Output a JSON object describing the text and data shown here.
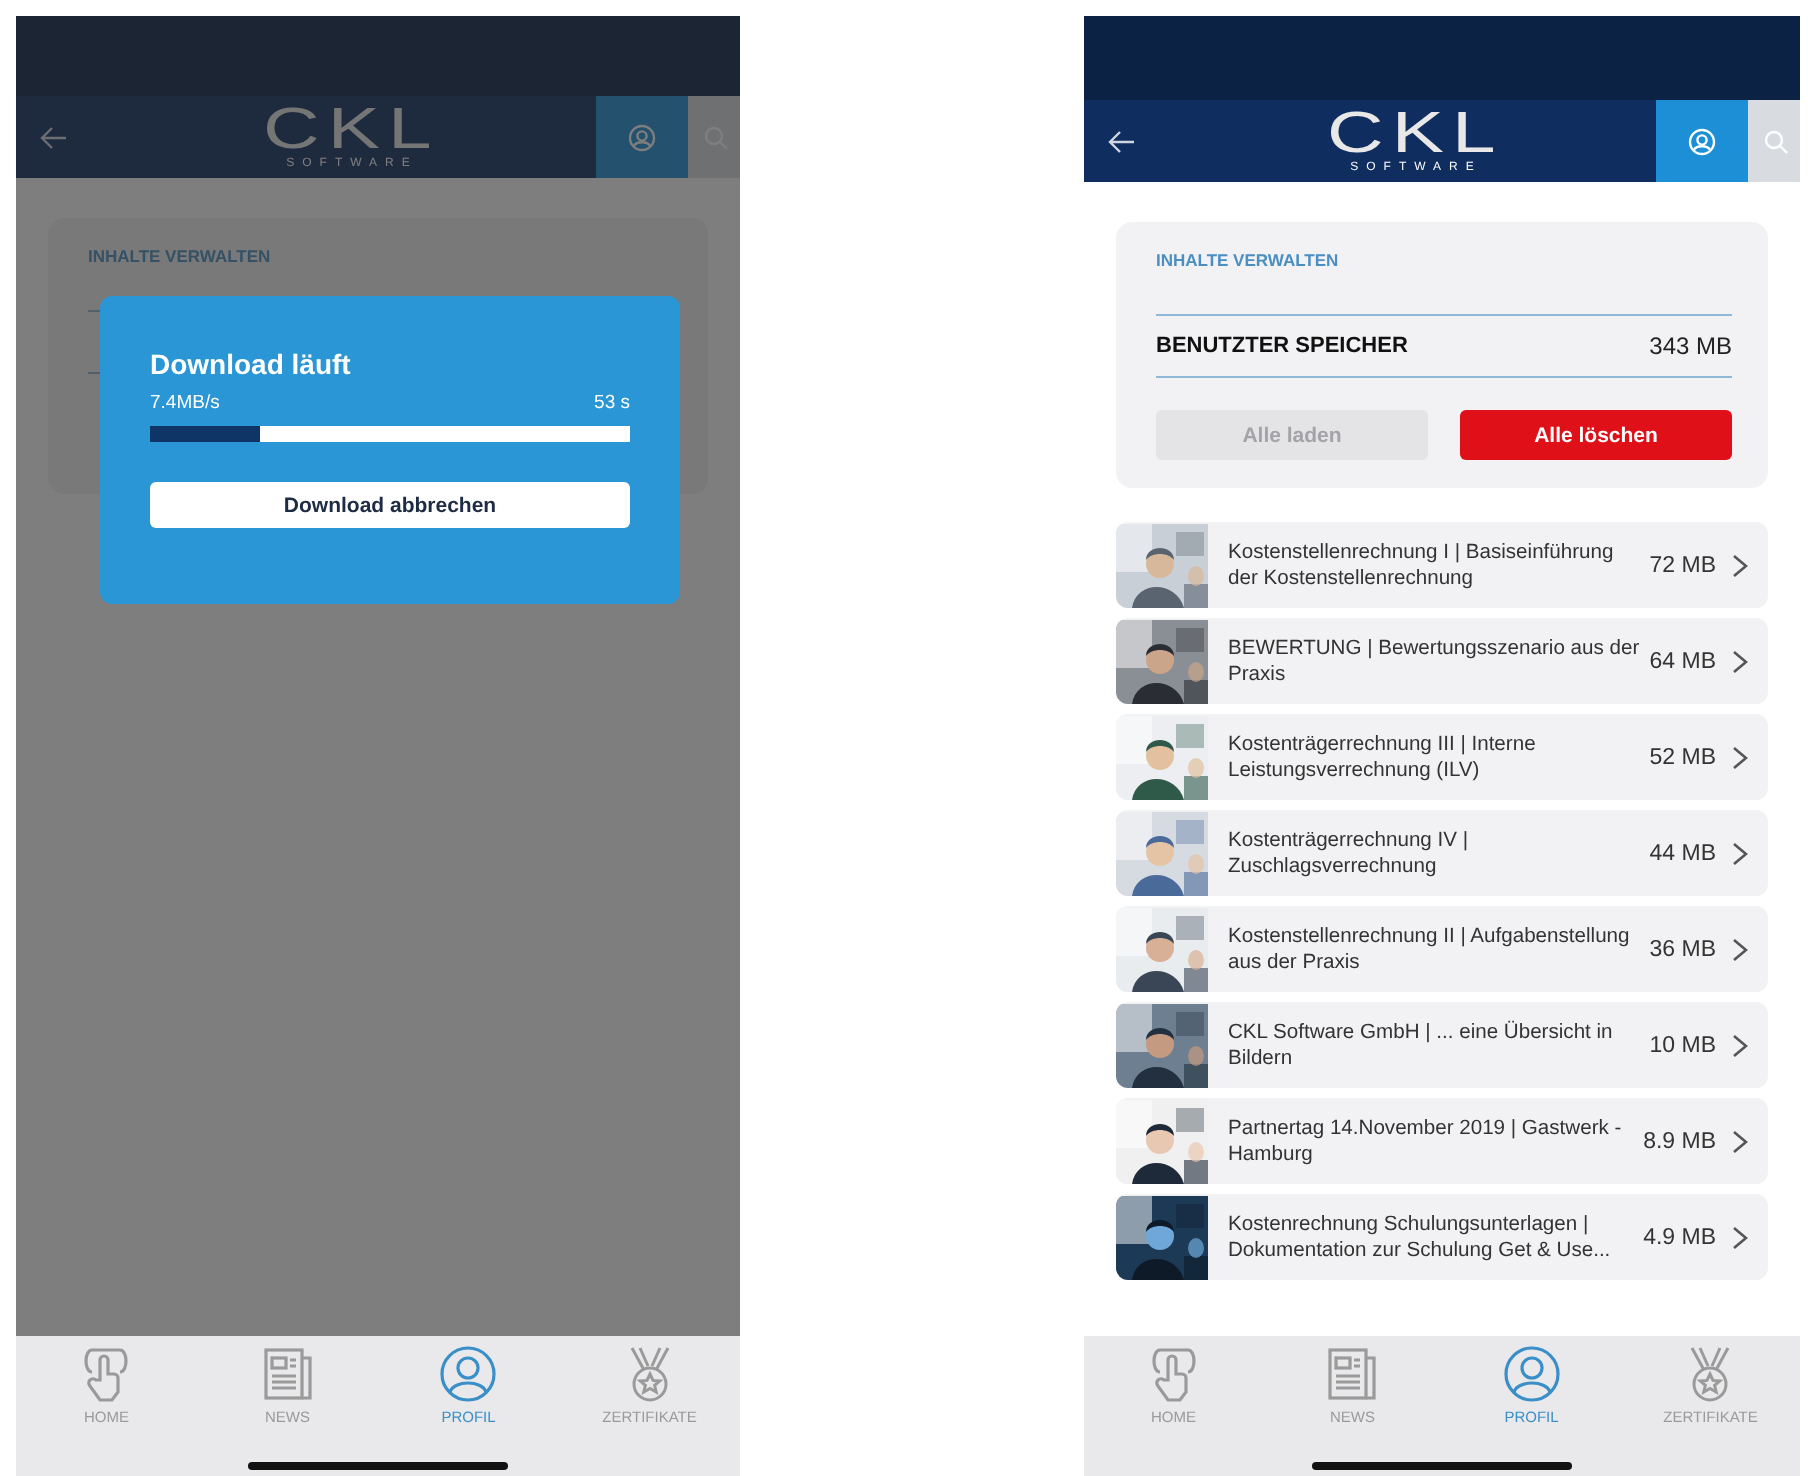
{
  "screens": [
    {
      "kind": "downloading",
      "header": {
        "logo": "CKL",
        "logo_subtitle": "SOFTWARE"
      },
      "card": {
        "title": "INHALTE VERWALTEN"
      },
      "dialog": {
        "title": "Download läuft",
        "speed": "7.4MB/s",
        "remaining": "53 s",
        "level": 0.23,
        "button": "Download abbrechen"
      },
      "tabs": [
        {
          "label": "HOME",
          "kind": "hand",
          "selected": false
        },
        {
          "label": "NEWS",
          "kind": "news",
          "selected": false
        },
        {
          "label": "PROFIL",
          "kind": "person",
          "selected": true
        },
        {
          "label": "ZERTIFIKATE",
          "kind": "medal",
          "selected": false
        }
      ]
    },
    {
      "kind": "list",
      "header": {
        "logo": "CKL",
        "logo_subtitle": "SOFTWARE"
      },
      "card": {
        "title": "INHALTE VERWALTEN",
        "storage_label": "BENUTZTER SPEICHER",
        "storage_value": "343 MB",
        "buttons": [
          {
            "label": "Alle laden",
            "kind": "load",
            "disabled": true
          },
          {
            "label": "Alle löschen",
            "kind": "delete",
            "disabled": false
          }
        ]
      },
      "items": [
        {
          "title": "Kostenstellenrechnung I | Basiseinführung der Kostenstellenrechnung",
          "size": "72 MB",
          "kind": "picture"
        },
        {
          "title": "BEWERTUNG | Bewertungsszenario aus der Praxis",
          "size": "64 MB",
          "kind": "picture"
        },
        {
          "title": "Kostenträgerrechnung III | Interne Leistungsverrechnung (ILV)",
          "size": "52 MB",
          "kind": "picture"
        },
        {
          "title": "Kostenträgerrechnung IV | Zuschlagsverrechnung",
          "size": "44 MB",
          "kind": "picture"
        },
        {
          "title": "Kostenstellenrechnung II | Aufgabenstellung aus der Praxis",
          "size": "36 MB",
          "kind": "picture"
        },
        {
          "title": "CKL Software GmbH | ... eine Übersicht in Bildern",
          "size": "10 MB",
          "kind": "picture"
        },
        {
          "title": "Partnertag 14.November 2019 | Gastwerk - Hamburg",
          "size": "8.9 MB",
          "kind": "picture"
        },
        {
          "title": "Kostenrechnung Schulungsunterlagen | Dokumentation zur Schulung Get & Use...",
          "size": "4.9 MB",
          "kind": "picture"
        }
      ],
      "tabs": [
        {
          "label": "HOME",
          "kind": "hand",
          "selected": false
        },
        {
          "label": "NEWS",
          "kind": "news",
          "selected": false
        },
        {
          "label": "PROFIL",
          "kind": "person",
          "selected": true
        },
        {
          "label": "ZERTIFIKATE",
          "kind": "medal",
          "selected": false
        }
      ]
    }
  ]
}
